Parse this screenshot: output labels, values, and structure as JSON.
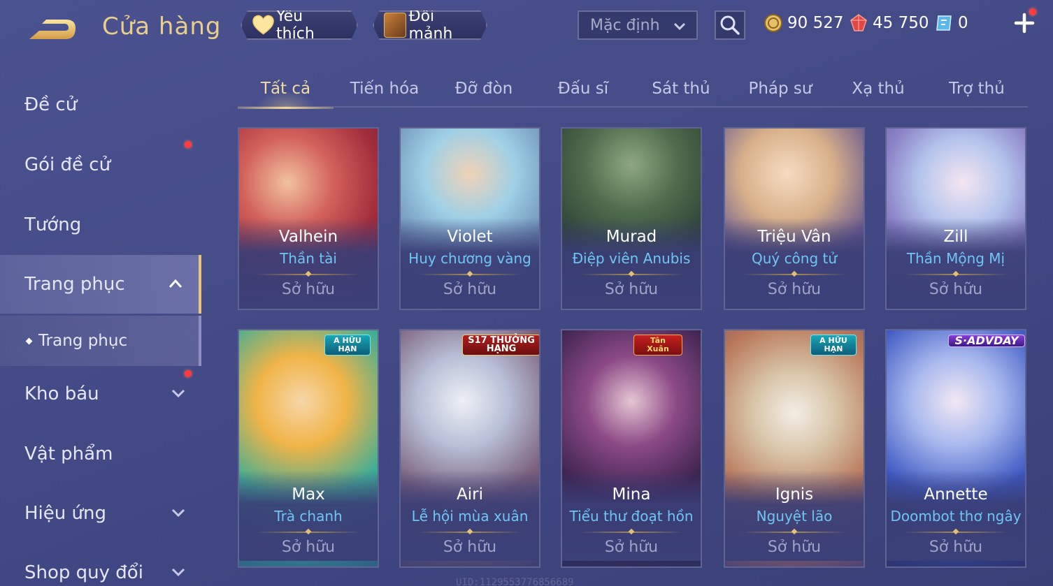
{
  "header": {
    "title": "Cửa hàng",
    "favorites_label": "Yêu thích",
    "exchange_label": "Đổi mảnh",
    "sort_value": "Mặc định",
    "currencies": [
      {
        "icon": "gold-coin-icon",
        "amount": "90 527"
      },
      {
        "icon": "red-gem-icon",
        "amount": "45 750"
      },
      {
        "icon": "voucher-icon",
        "amount": "0"
      }
    ]
  },
  "sidebar": {
    "items": [
      {
        "label": "Đề cử"
      },
      {
        "label": "Gói đề cử"
      },
      {
        "label": "Tướng"
      },
      {
        "label": "Trang phục"
      },
      {
        "label": "Trang phục"
      },
      {
        "label": "Kho báu"
      },
      {
        "label": "Vật phẩm"
      },
      {
        "label": "Hiệu ứng"
      },
      {
        "label": "Shop quy đổi"
      }
    ]
  },
  "tabs": [
    "Tất cả",
    "Tiến hóa",
    "Đỡ đòn",
    "Đấu sĩ",
    "Sát thủ",
    "Pháp sư",
    "Xạ thủ",
    "Trợ thủ"
  ],
  "cards": [
    {
      "hero": "Valhein",
      "skin": "Thần tài",
      "status": "Sở hữu",
      "badge": ""
    },
    {
      "hero": "Violet",
      "skin": "Huy chương vàng",
      "status": "Sở hữu",
      "badge": ""
    },
    {
      "hero": "Murad",
      "skin": "Điệp viên Anubis",
      "status": "Sở hữu",
      "badge": ""
    },
    {
      "hero": "Triệu Vân",
      "skin": "Quý công tử",
      "status": "Sở hữu",
      "badge": ""
    },
    {
      "hero": "Zill",
      "skin": "Thần Mộng Mị",
      "status": "Sở hữu",
      "badge": ""
    },
    {
      "hero": "Max",
      "skin": "Trà chanh",
      "status": "Sở hữu",
      "badge": "A HỮU HẠN"
    },
    {
      "hero": "Airi",
      "skin": "Lễ hội mùa xuân",
      "status": "Sở hữu",
      "badge": "S17 THƯỞNG HẠNG"
    },
    {
      "hero": "Mina",
      "skin": "Tiểu thư đoạt hồn",
      "status": "Sở hữu",
      "badge": "Tân Xuân"
    },
    {
      "hero": "Ignis",
      "skin": "Nguyệt lão",
      "status": "Sở hữu",
      "badge": "A HỮU HẠN"
    },
    {
      "hero": "Annette",
      "skin": "Doombot thơ ngây",
      "status": "Sở hữu",
      "badge": "S·ADVDAY"
    }
  ],
  "uid_text": "UID:1129553776856689"
}
